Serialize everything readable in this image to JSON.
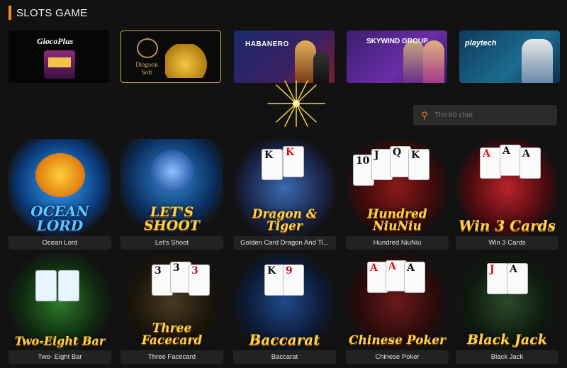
{
  "section": {
    "title": "SLOTS GAME"
  },
  "providers": [
    {
      "name": "GiocoPlus",
      "label": "GiocoPlus"
    },
    {
      "name": "Dragoon Soft",
      "label": "Dragoon Soft"
    },
    {
      "name": "Habanero",
      "label": "HABANERO"
    },
    {
      "name": "Skywind Group",
      "label": "SKYWIND GROUP"
    },
    {
      "name": "Playtech",
      "label": "playtech"
    }
  ],
  "search": {
    "placeholder": "Tìm trò chơi",
    "value": ""
  },
  "games": [
    {
      "title": "Ocean Lord",
      "logo": "OCEAN LORD"
    },
    {
      "title": "Let's Shoot",
      "logo": "LET'S SHOOT"
    },
    {
      "title": "Golden Card Dragon And Ti...",
      "logo": "Dragon & Tiger"
    },
    {
      "title": "Hundred NiuNiu",
      "logo": "Hundred NiuNiu"
    },
    {
      "title": "Win 3 Cards",
      "logo": "Win 3 Cards"
    },
    {
      "title": "Two- Eight Bar",
      "logo": "Two-Eight Bar"
    },
    {
      "title": "Three Facecard",
      "logo": "Three Facecard"
    },
    {
      "title": "Baccarat",
      "logo": "Baccarat"
    },
    {
      "title": "Chinese Poker",
      "logo": "Chinese Poker"
    },
    {
      "title": "Black Jack",
      "logo": "Black Jack"
    }
  ],
  "colors": {
    "accent": "#f08a1c",
    "background": "#121212",
    "caption_bg": "#222222"
  }
}
